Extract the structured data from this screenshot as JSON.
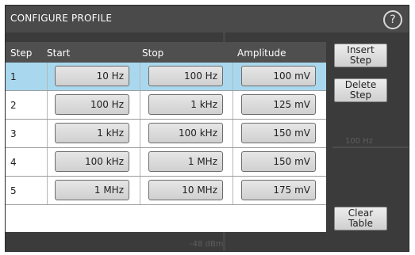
{
  "dialog": {
    "title": "CONFIGURE PROFILE",
    "help_label": "?"
  },
  "table": {
    "headers": [
      "Step",
      "Start",
      "Stop",
      "Amplitude"
    ],
    "rows": [
      {
        "step": "1",
        "start": "10 Hz",
        "stop": "100 Hz",
        "amplitude": "100 mV",
        "selected": true
      },
      {
        "step": "2",
        "start": "100 Hz",
        "stop": "1 kHz",
        "amplitude": "125 mV",
        "selected": false
      },
      {
        "step": "3",
        "start": "1 kHz",
        "stop": "100 kHz",
        "amplitude": "150 mV",
        "selected": false
      },
      {
        "step": "4",
        "start": "100 kHz",
        "stop": "1 MHz",
        "amplitude": "150 mV",
        "selected": false
      },
      {
        "step": "5",
        "start": "1 MHz",
        "stop": "10 MHz",
        "amplitude": "175 mV",
        "selected": false
      }
    ],
    "selected_row_color": "#a9d8ee"
  },
  "buttons": {
    "insert_line1": "Insert",
    "insert_line2": "Step",
    "delete_line1": "Delete",
    "delete_line2": "Step",
    "clear_line1": "Clear",
    "clear_line2": "Table"
  },
  "background": {
    "freq_label": "100 Hz",
    "level_label": "-48 dBm"
  },
  "icons": {
    "help": "question-circle-icon"
  }
}
